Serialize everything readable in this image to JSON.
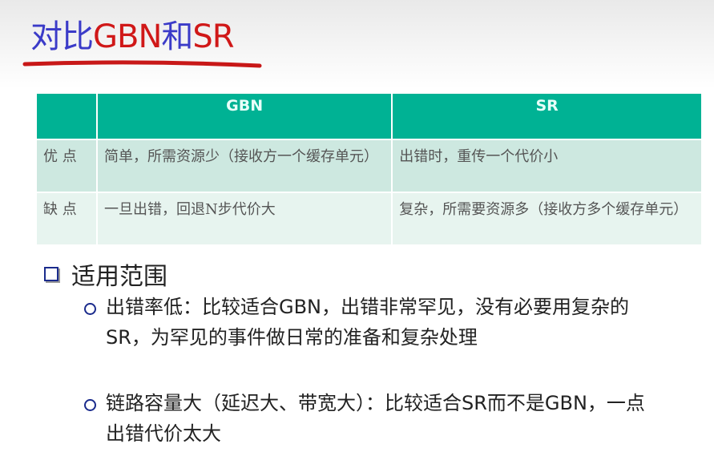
{
  "title": {
    "part1": "对比",
    "part2": "GBN",
    "part3": "和",
    "part4": "SR"
  },
  "table": {
    "headers": [
      "",
      "GBN",
      "SR"
    ],
    "rows": [
      {
        "label": "优 点",
        "gbn": "简单，所需资源少（接收方一个缓存单元）",
        "sr": "出错时，重传一个代价小"
      },
      {
        "label": "缺 点",
        "gbn": "一旦出错，回退N步代价大",
        "sr": "复杂，所需要资源多（接收方多个缓存单元）"
      }
    ]
  },
  "section": {
    "heading": "适用范围",
    "bullets": [
      "出错率低：比较适合GBN，出错非常罕见，没有必要用复杂的SR，为罕见的事件做日常的准备和复杂处理",
      "链路容量大（延迟大、带宽大）：比较适合SR而不是GBN，一点出错代价太大"
    ]
  }
}
